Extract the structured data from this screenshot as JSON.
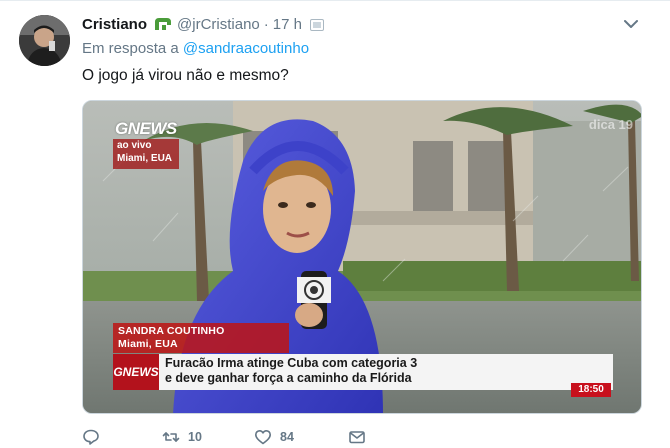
{
  "tweet": {
    "author_name": "Cristiano",
    "author_handle": "@jrCristiano",
    "separator": "·",
    "timestamp": "17 h",
    "reply_prefix": "Em resposta a",
    "reply_to": "@sandraacoutinho",
    "text": "O jogo já virou não e mesmo?"
  },
  "media": {
    "channel_logo": "GNEWS",
    "watermark": "dica 19",
    "live_label": "ao vivo",
    "live_location": "Miami, EUA",
    "reporter_name": "SANDRA COUTINHO",
    "reporter_location": "Miami, EUA",
    "headline_logo": "GNEWS",
    "headline_line1": "Furacão Irma atinge Cuba com categoria 3",
    "headline_line2": "e deve ganhar força a caminho da Flórida",
    "clock": "18:50"
  },
  "actions": {
    "reply_icon": "reply-icon",
    "retweet_icon": "retweet-icon",
    "retweet_count": "10",
    "like_icon": "like-icon",
    "like_count": "84",
    "dm_icon": "envelope-icon"
  },
  "colors": {
    "link": "#1da1f2",
    "muted": "#657786",
    "badge_green": "#4a9c3a",
    "news_red": "#b3121c"
  }
}
